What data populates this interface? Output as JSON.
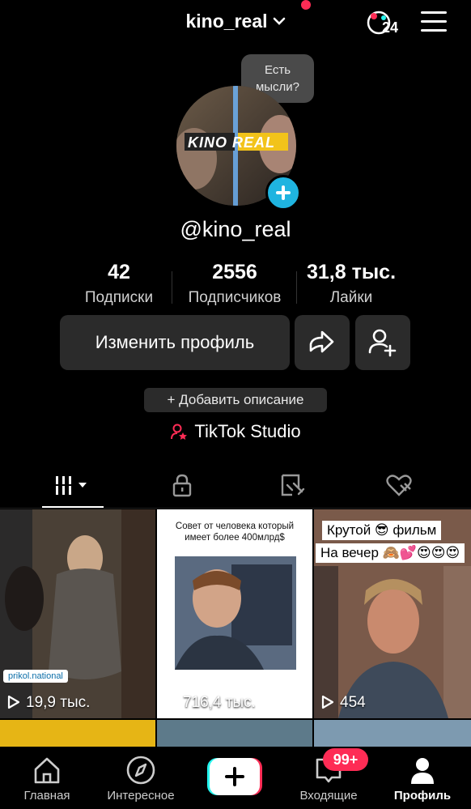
{
  "header": {
    "username": "kino_real",
    "notif_badge": "24",
    "bubble_text": "Есть мысли?"
  },
  "profile": {
    "handle": "@kino_real",
    "avatar_logo": "KINO REAL"
  },
  "stats": [
    {
      "value": "42",
      "label": "Подписки"
    },
    {
      "value": "2556",
      "label": "Подписчиков"
    },
    {
      "value": "31,8 тыс.",
      "label": "Лайки"
    }
  ],
  "actions": {
    "edit_profile": "Изменить профиль",
    "add_description": "+ Добавить описание",
    "studio": "TikTok Studio"
  },
  "tabs": [
    {
      "icon": "grid-icon"
    },
    {
      "icon": "lock-icon"
    },
    {
      "icon": "tagged-icon"
    },
    {
      "icon": "liked-icon"
    }
  ],
  "videos": [
    {
      "views": "19,9 тыс.",
      "overlay": "prikol.national"
    },
    {
      "views": "716,4 тыс.",
      "caption": "Совет от человека который имеет более 400млрд$"
    },
    {
      "views": "454",
      "caption_line1": "Крутой 😎 фильм",
      "caption_line2": "На вечер 🙈💕😍😍😍"
    }
  ],
  "nav": {
    "home": "Главная",
    "discover": "Интересное",
    "inbox": "Входящие",
    "profile": "Профиль",
    "inbox_badge": "99+"
  },
  "colors": {
    "accent": "#fe2c55",
    "cyan": "#25f4ee",
    "plus_badge": "#1fb4e0"
  }
}
